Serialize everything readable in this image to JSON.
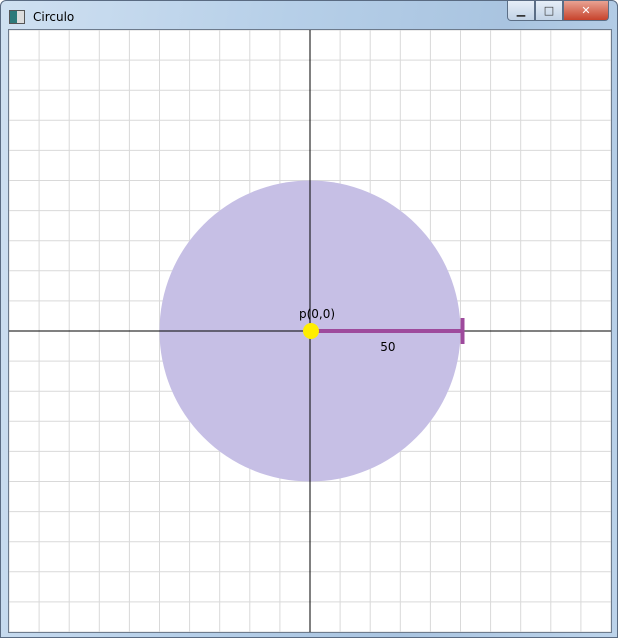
{
  "window": {
    "title": "Circulo",
    "minimize_icon": "minimize-icon",
    "maximize_icon": "maximize-icon",
    "close_icon": "close-icon"
  },
  "plot": {
    "center_label": "p(0,0)",
    "radius": 50,
    "radius_label": "50",
    "grid_step_units": 10,
    "range_units": 100,
    "colors": {
      "circle": "#c6bfe5",
      "radius": "#9e4a9c",
      "center": "#ffee00",
      "grid": "#d9d9d9",
      "axis": "#000000"
    }
  }
}
